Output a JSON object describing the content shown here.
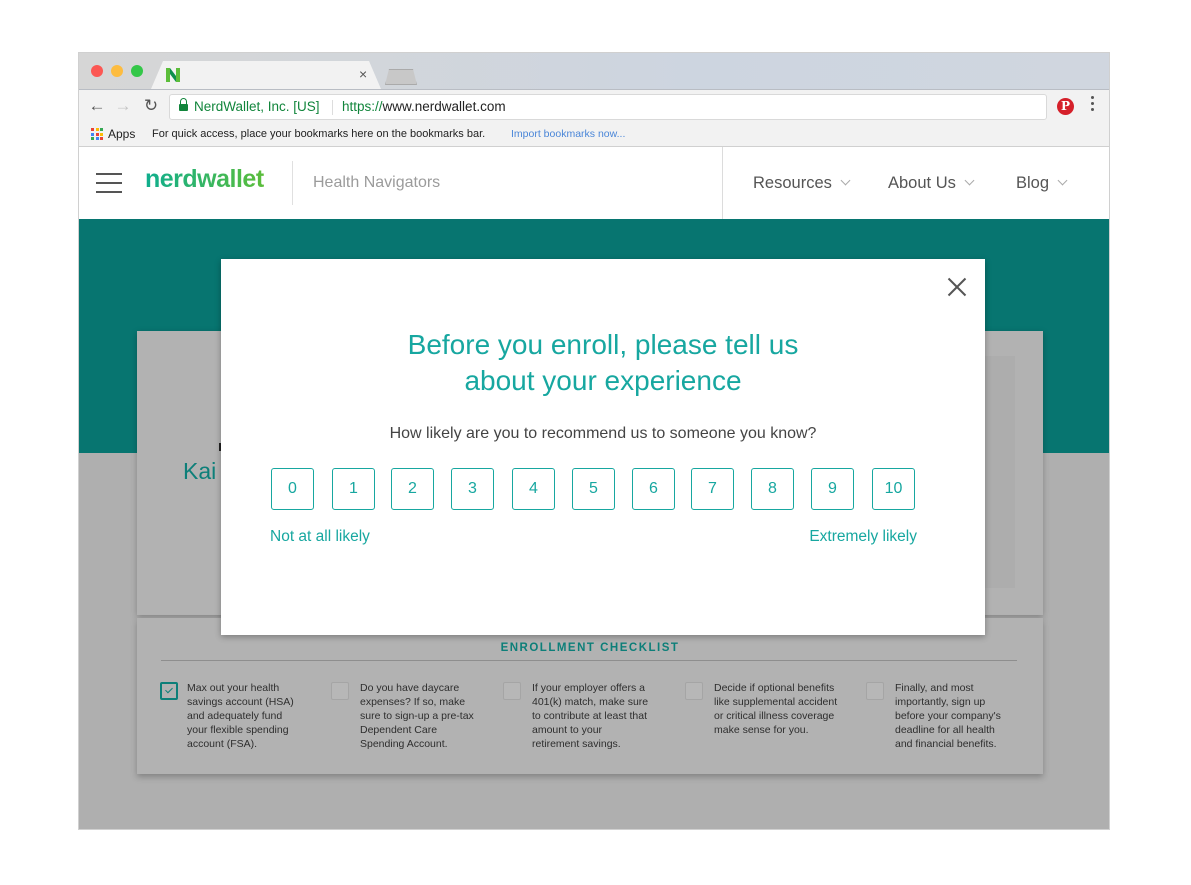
{
  "browser": {
    "tab_close": "×",
    "nav": {
      "back": "←",
      "forward": "→",
      "reload": "↻"
    },
    "secure_label": "NerdWallet, Inc. [US]",
    "url_scheme": "https://",
    "url_host": "www.nerdwallet.com",
    "bookmark_star": "☆",
    "extension_pinterest": "P",
    "bookmarks_bar": {
      "apps_label": "Apps",
      "hint": "For quick access, place your bookmarks here on the bookmarks bar.",
      "import_link": "Import bookmarks now..."
    },
    "apps_icon_colors": [
      "#ea4335",
      "#fbbc05",
      "#34a853",
      "#4285f4",
      "#ea4335",
      "#fbbc05",
      "#34a853",
      "#4285f4",
      "#ea4335"
    ]
  },
  "site": {
    "logo": "nerdwallet",
    "section": "Health Navigators",
    "nav": [
      {
        "label": "Resources"
      },
      {
        "label": "About Us"
      },
      {
        "label": "Blog"
      }
    ],
    "colors": {
      "brand_teal": "#077570",
      "accent": "#17a7a0",
      "logo_green": "#5bbd3a"
    }
  },
  "background_page": {
    "provider_partial": "Kai",
    "checklist": {
      "title": "ENROLLMENT CHECKLIST",
      "items": [
        {
          "checked": true,
          "lines": [
            "Max out your health",
            "savings account (HSA)",
            "and adequately fund",
            "your flexible spending",
            "account (FSA)."
          ]
        },
        {
          "checked": false,
          "lines": [
            "Do you have daycare",
            "expenses? If so, make",
            "sure to sign-up a pre-tax",
            "Dependent Care",
            "Spending Account."
          ]
        },
        {
          "checked": false,
          "lines": [
            "If your employer offers a",
            "401(k) match, make sure",
            "to contribute at least that",
            "amount to your",
            "retirement savings."
          ]
        },
        {
          "checked": false,
          "lines": [
            "Decide if optional benefits",
            "like supplemental accident",
            "or critical illness coverage",
            "make sense for you."
          ]
        },
        {
          "checked": false,
          "lines": [
            "Finally, and most",
            "importantly, sign up",
            "before your company's",
            "deadline for all health",
            "and financial benefits."
          ]
        }
      ]
    }
  },
  "modal": {
    "title_line1": "Before you enroll, please tell us",
    "title_line2": "about your experience",
    "question": "How likely are you to recommend us to someone you know?",
    "scores": [
      "0",
      "1",
      "2",
      "3",
      "4",
      "5",
      "6",
      "7",
      "8",
      "9",
      "10"
    ],
    "low_label": "Not at all likely",
    "high_label": "Extremely likely"
  }
}
